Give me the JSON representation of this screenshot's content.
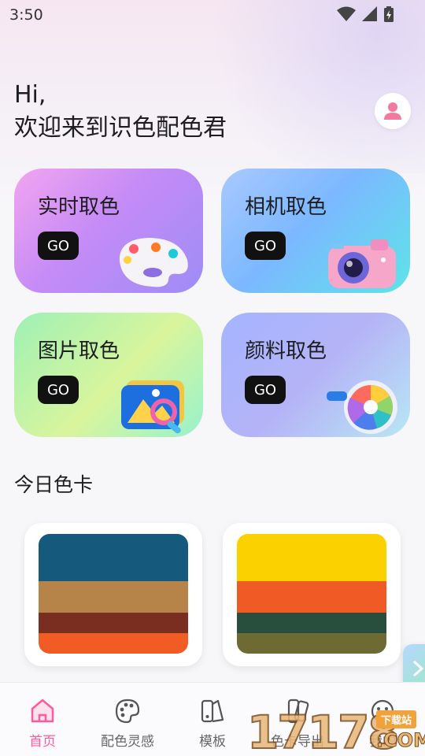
{
  "status_bar": {
    "time": "3:50"
  },
  "header": {
    "greeting_line1": "Hi,",
    "greeting_line2": "欢迎来到识色配色君"
  },
  "cards": [
    {
      "title": "实时取色",
      "go": "GO"
    },
    {
      "title": "相机取色",
      "go": "GO"
    },
    {
      "title": "图片取色",
      "go": "GO"
    },
    {
      "title": "颜料取色",
      "go": "GO"
    }
  ],
  "today": {
    "title": "今日色卡",
    "palettes": [
      {
        "colors": [
          "#155a7c",
          "#b68349",
          "#7a2e1f",
          "#f05c23"
        ],
        "weights": [
          60,
          40,
          26,
          26
        ]
      },
      {
        "colors": [
          "#fcd100",
          "#f05a24",
          "#284e3d",
          "#6e6a34"
        ],
        "weights": [
          60,
          40,
          26,
          26
        ]
      }
    ]
  },
  "bottom_nav": {
    "items": [
      {
        "label": "首页",
        "icon": "home-icon",
        "active": true
      },
      {
        "label": "配色灵感",
        "icon": "palette-icon",
        "active": false
      },
      {
        "label": "模板",
        "icon": "template-icon",
        "active": false
      },
      {
        "label": "色卡导出",
        "icon": "color-card-icon",
        "active": false
      },
      {
        "label": "我的",
        "icon": "profile-icon",
        "active": false
      }
    ]
  },
  "watermark": {
    "digits": "17178",
    "badge": "下载站",
    "suffix": ".COM"
  },
  "colors": {
    "accent": "#ff5aa0",
    "go_button": "#111111"
  }
}
